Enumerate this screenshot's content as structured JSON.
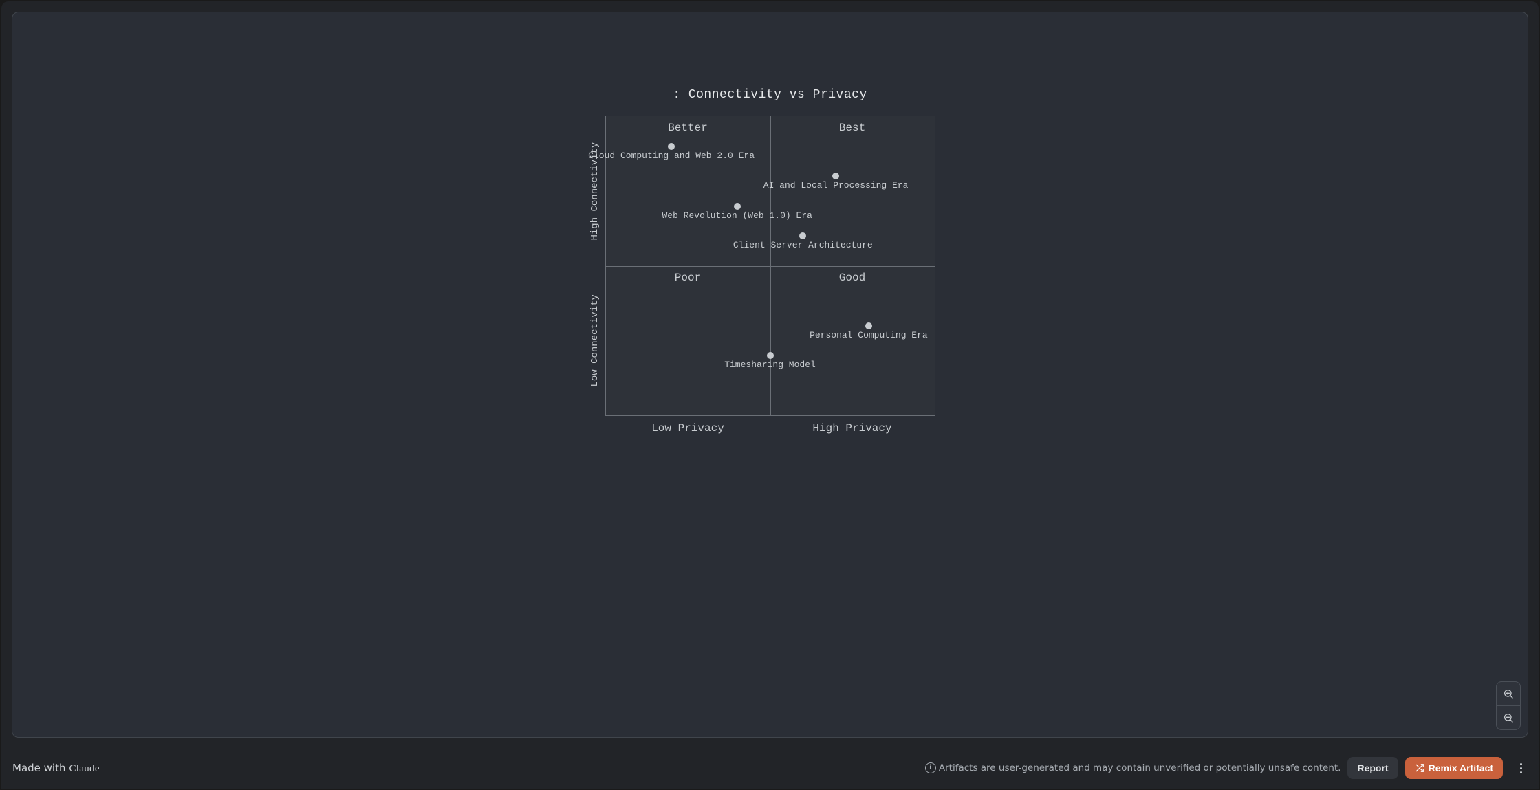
{
  "chart": {
    "title": ": Connectivity vs Privacy",
    "quadrant_labels": {
      "top_left": "Better",
      "top_right": "Best",
      "bottom_left": "Poor",
      "bottom_right": "Good"
    },
    "y_axis": {
      "high": "High Connectivity",
      "low": "Low Connectivity"
    },
    "x_axis": {
      "low": "Low Privacy",
      "high": "High Privacy"
    }
  },
  "chart_data": {
    "type": "scatter",
    "title": ": Connectivity vs Privacy",
    "xlabel": "Privacy",
    "ylabel": "Connectivity",
    "x_axis_labels": [
      "Low Privacy",
      "High Privacy"
    ],
    "y_axis_labels": [
      "Low Connectivity",
      "High Connectivity"
    ],
    "quadrant_labels": {
      "top_left": "Better",
      "top_right": "Best",
      "bottom_left": "Poor",
      "bottom_right": "Good"
    },
    "xlim": [
      0,
      1
    ],
    "ylim": [
      0,
      1
    ],
    "series": [
      {
        "name": "points",
        "points": [
          {
            "label": "Cloud Computing and Web 2.0 Era",
            "x": 0.2,
            "y": 0.9
          },
          {
            "label": "AI and Local Processing Era",
            "x": 0.7,
            "y": 0.8
          },
          {
            "label": "Web Revolution (Web 1.0) Era",
            "x": 0.4,
            "y": 0.7
          },
          {
            "label": "Client-Server Architecture",
            "x": 0.6,
            "y": 0.6
          },
          {
            "label": "Personal Computing Era",
            "x": 0.8,
            "y": 0.3
          },
          {
            "label": "Timesharing Model",
            "x": 0.5,
            "y": 0.2
          }
        ]
      }
    ]
  },
  "footer": {
    "made_with_prefix": "Made with",
    "made_with_brand": "Claude",
    "disclaimer": "Artifacts are user-generated and may contain unverified or potentially unsafe content.",
    "report_label": "Report",
    "remix_label": "Remix Artifact"
  }
}
